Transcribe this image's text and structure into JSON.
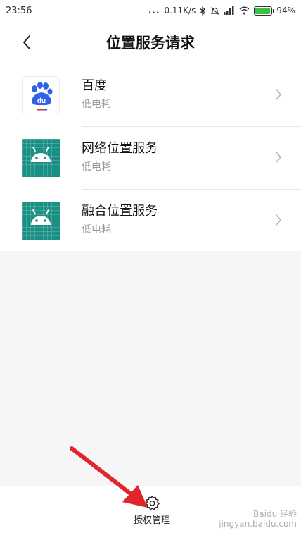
{
  "status_bar": {
    "time": "23:56",
    "dots": "...",
    "network_speed": "0.11K/s",
    "battery_percent": "94%",
    "battery_level": 0.94,
    "battery_color": "#38c240"
  },
  "header": {
    "title": "位置服务请求",
    "back_icon": "chevron-left-icon"
  },
  "items": [
    {
      "title": "百度",
      "subtitle": "低电耗",
      "icon": "baidu-paw-icon"
    },
    {
      "title": "网络位置服务",
      "subtitle": "低电耗",
      "icon": "android-icon"
    },
    {
      "title": "融合位置服务",
      "subtitle": "低电耗",
      "icon": "android-icon"
    }
  ],
  "footer": {
    "auth_label": "授权管理",
    "auth_icon": "gear-icon"
  },
  "annotation": {
    "arrow_color": "#e0262b"
  },
  "watermark": {
    "line1": "Baidu 经验",
    "line2": "jingyan.baidu.com"
  },
  "colors": {
    "android_green": "#1a8f83",
    "baidu_blue": "#2e63e8",
    "baidu_red": "#e03131"
  }
}
